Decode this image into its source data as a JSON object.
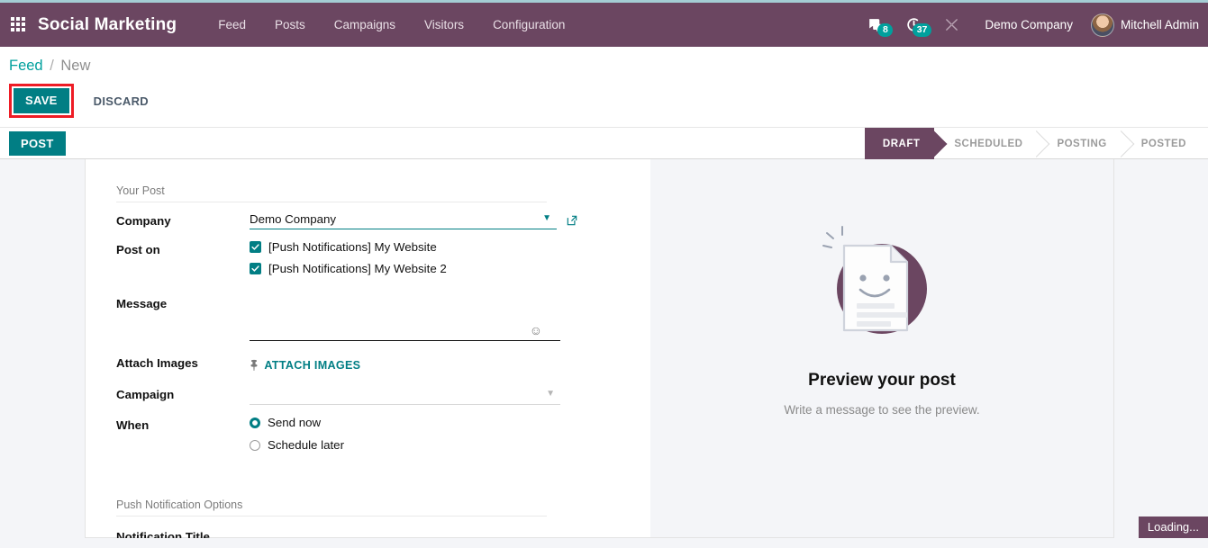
{
  "navbar": {
    "apps_icon": "apps-grid-icon",
    "brand": "Social Marketing",
    "menu": [
      {
        "label": "Feed"
      },
      {
        "label": "Posts"
      },
      {
        "label": "Campaigns"
      },
      {
        "label": "Visitors"
      },
      {
        "label": "Configuration"
      }
    ],
    "messages_badge": "8",
    "activities_badge": "37",
    "debug_icon": "wrench-icon",
    "company": "Demo Company",
    "user": "Mitchell Admin"
  },
  "breadcrumb": {
    "root": "Feed",
    "separator": "/",
    "current": "New"
  },
  "actions": {
    "save": "SAVE",
    "discard": "DISCARD",
    "post": "POST",
    "highlight_color": "#ee1c25",
    "primary_color": "#017e84"
  },
  "pipeline": {
    "stages": [
      {
        "label": "DRAFT",
        "active": true
      },
      {
        "label": "SCHEDULED",
        "active": false
      },
      {
        "label": "POSTING",
        "active": false
      },
      {
        "label": "POSTED",
        "active": false
      }
    ],
    "active_color": "#6b4661"
  },
  "form": {
    "group_title": "Your Post",
    "company_label": "Company",
    "company_value": "Demo Company",
    "post_on_label": "Post on",
    "accounts": [
      {
        "label": "[Push Notifications] My Website",
        "checked": true
      },
      {
        "label": "[Push Notifications] My Website 2",
        "checked": true
      }
    ],
    "message_label": "Message",
    "message_value": "",
    "attach_label": "Attach Images",
    "attach_button": "ATTACH IMAGES",
    "campaign_label": "Campaign",
    "campaign_value": "",
    "when_label": "When",
    "when_options": [
      {
        "label": "Send now",
        "selected": true
      },
      {
        "label": "Schedule later",
        "selected": false
      }
    ],
    "push_group_title": "Push Notification Options",
    "notification_title_label": "Notification Title"
  },
  "preview": {
    "title": "Preview your post",
    "subtitle": "Write a message to see the preview.",
    "illustration": "empty-post-placeholder-icon"
  },
  "status": {
    "loading": "Loading..."
  }
}
